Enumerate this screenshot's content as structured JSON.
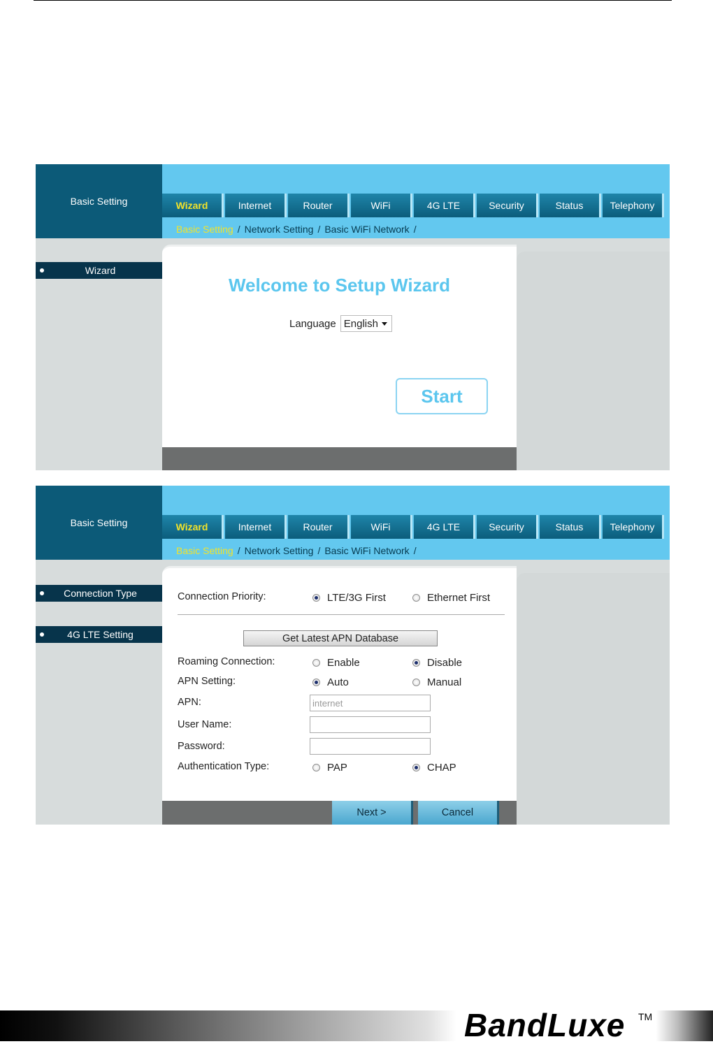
{
  "header": {
    "brand": "Basic Setting"
  },
  "tabs": [
    "Wizard",
    "Internet",
    "Router",
    "WiFi",
    "4G LTE",
    "Security",
    "Status",
    "Telephony"
  ],
  "breadcrumb": {
    "current": "Basic Setting",
    "items": [
      "Network Setting",
      "Basic WiFi Network"
    ],
    "separator": "/"
  },
  "screen1": {
    "sidebar_item": "Wizard",
    "title": "Welcome to Setup Wizard",
    "language_label": "Language",
    "language_value": "English",
    "start_button": "Start"
  },
  "screen2": {
    "sidebar_items": [
      "Connection Type",
      "4G LTE Setting"
    ],
    "connection_priority": {
      "label": "Connection Priority:",
      "options": [
        "LTE/3G First",
        "Ethernet First"
      ],
      "selected": "LTE/3G First"
    },
    "apn_button": "Get Latest APN Database",
    "roaming": {
      "label": "Roaming Connection:",
      "options": [
        "Enable",
        "Disable"
      ],
      "selected": "Disable"
    },
    "apn_setting": {
      "label": "APN Setting:",
      "options": [
        "Auto",
        "Manual"
      ],
      "selected": "Auto"
    },
    "apn": {
      "label": "APN:",
      "placeholder": "internet"
    },
    "username": {
      "label": "User Name:",
      "value": ""
    },
    "password": {
      "label": "Password:",
      "value": ""
    },
    "auth_type": {
      "label": "Authentication Type:",
      "options": [
        "PAP",
        "CHAP"
      ],
      "selected": "CHAP"
    },
    "next_button": "Next >",
    "cancel_button": "Cancel"
  },
  "footer": {
    "logo": "BandLuxe",
    "tm": "TM"
  },
  "colors": {
    "accent": "#63c8ef",
    "nav_dark": "#0c5a78",
    "highlight": "#f2e32a",
    "welcome": "#5bc6ee"
  }
}
